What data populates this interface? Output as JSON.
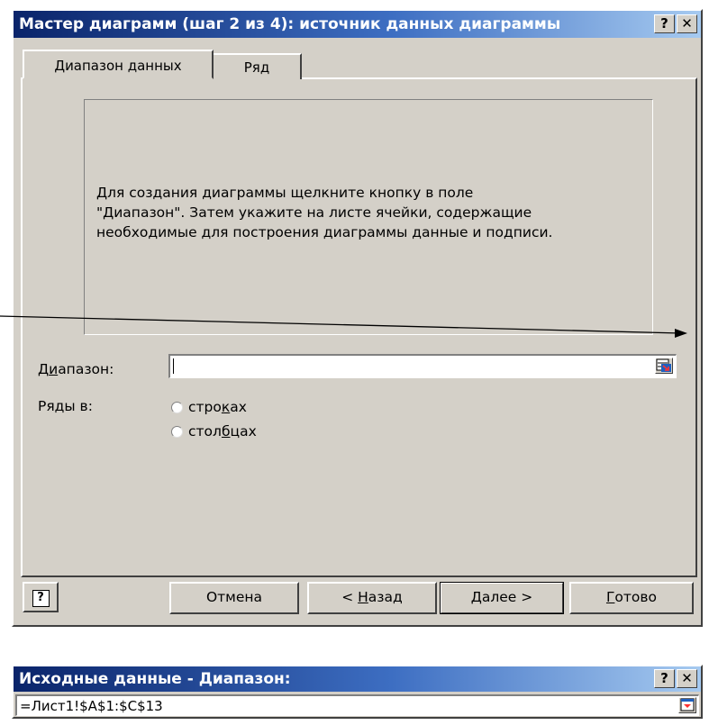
{
  "wizard": {
    "title": "Мастер диаграмм (шаг 2 из 4): источник данных диаграммы",
    "help_glyph": "?",
    "close_glyph": "✕",
    "tabs": [
      {
        "label": "Диапазон данных",
        "active": true
      },
      {
        "label": "Ряд",
        "active": false
      }
    ],
    "hint_lines": [
      "Для создания диаграммы щелкните кнопку в поле",
      "\"Диапазон\". Затем укажите на листе ячейки, содержащие",
      "необходимые для построения диаграммы данные и подписи."
    ],
    "range_label": {
      "pre": "Д",
      "accel": "и",
      "post": "апазон:"
    },
    "range_value": "",
    "series_label": "Ряды в:",
    "series_options": [
      {
        "pre": "стро",
        "accel": "к",
        "post": "ах",
        "selected": false
      },
      {
        "pre": "стол",
        "accel": "б",
        "post": "цах",
        "selected": false
      }
    ],
    "buttons": {
      "help_glyph": "?",
      "cancel": "Отмена",
      "back": {
        "pre": "< ",
        "accel": "Н",
        "post": "азад"
      },
      "next": {
        "pre": "",
        "accel": "Д",
        "post": "алее >"
      },
      "finish": {
        "pre": "",
        "accel": "Г",
        "post": "отово"
      }
    }
  },
  "source_bar": {
    "title": "Исходные данные - Диапазон:",
    "help_glyph": "?",
    "close_glyph": "✕",
    "value": "=Лист1!$A$1:$C$13"
  },
  "colors": {
    "title_start": "#0a246a",
    "title_end": "#a6caf0",
    "face": "#d4d0c8"
  }
}
